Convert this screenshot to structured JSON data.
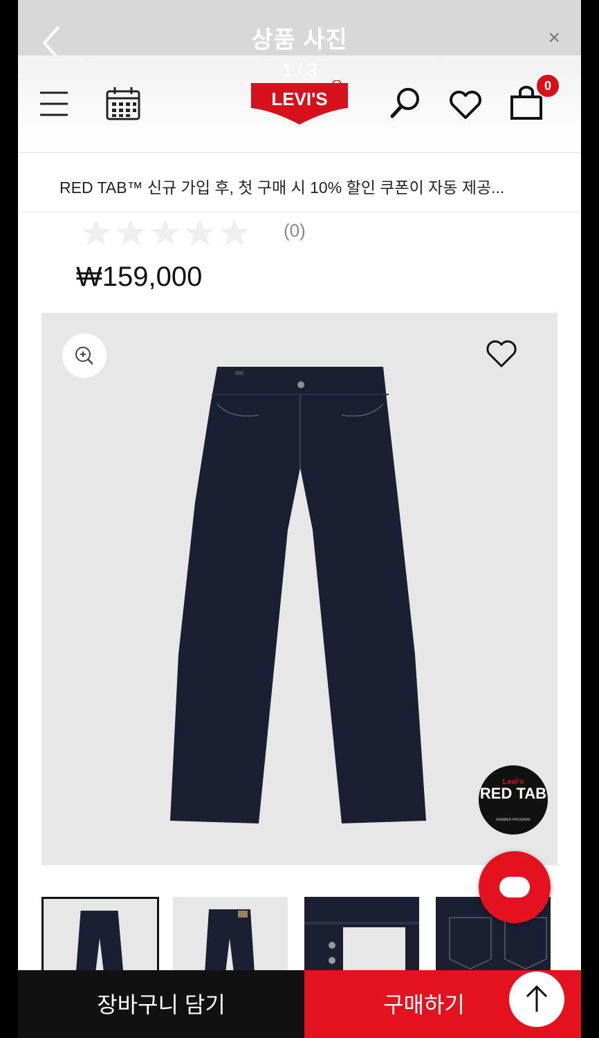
{
  "viewer": {
    "title": "상품 사진",
    "counter": "1 / 3",
    "close_label": "×"
  },
  "header": {
    "logo_text": "LEVI'S",
    "cart_count": "0"
  },
  "promo": {
    "text": "RED TAB™ 신규 가입 후, 첫 구매 시 10% 할인 쿠폰이 자동 제공..."
  },
  "product": {
    "rating_stars": 0,
    "review_count": "(0)",
    "price": "₩159,000",
    "badge": {
      "line1": "Levi's",
      "line2": "RED TAB",
      "line3": "MEMBER PROGRAM"
    }
  },
  "thumbnails": [
    {
      "name": "thumb-front",
      "active": true
    },
    {
      "name": "thumb-back",
      "active": false
    },
    {
      "name": "thumb-detail-fly",
      "active": false
    },
    {
      "name": "thumb-detail-pocket",
      "active": false
    }
  ],
  "bottom": {
    "cart_label": "장바구니 담기",
    "buy_label": "구매하기"
  },
  "colors": {
    "brand_red": "#e4121f",
    "denim": "#1a2031",
    "black": "#111111"
  },
  "icons": [
    "back-icon",
    "close-icon",
    "menu-icon",
    "calendar-icon",
    "search-icon",
    "heart-icon",
    "bag-icon",
    "zoom-icon",
    "chat-icon",
    "arrow-up-icon"
  ]
}
